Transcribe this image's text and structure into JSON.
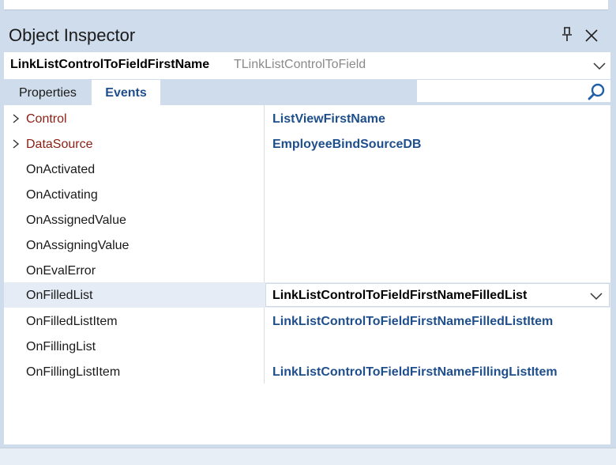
{
  "panel": {
    "title": "Object Inspector"
  },
  "selector": {
    "object_name": "LinkListControlToFieldFirstName",
    "object_type": "TLinkListControlToField"
  },
  "tabs": [
    {
      "label": "Properties",
      "active": false
    },
    {
      "label": "Events",
      "active": true
    }
  ],
  "search": {
    "value": "",
    "icon": "search-icon"
  },
  "rows": [
    {
      "name": "Control",
      "value": "ListViewFirstName",
      "expandable": true
    },
    {
      "name": "DataSource",
      "value": "EmployeeBindSourceDB",
      "expandable": true
    },
    {
      "name": "OnActivated",
      "value": ""
    },
    {
      "name": "OnActivating",
      "value": ""
    },
    {
      "name": "OnAssignedValue",
      "value": ""
    },
    {
      "name": "OnAssigningValue",
      "value": ""
    },
    {
      "name": "OnEvalError",
      "value": ""
    },
    {
      "name": "OnFilledList",
      "value": "LinkListControlToFieldFirstNameFilledList",
      "selected": true
    },
    {
      "name": "OnFilledListItem",
      "value": "LinkListControlToFieldFirstNameFilledListItem"
    },
    {
      "name": "OnFillingList",
      "value": ""
    },
    {
      "name": "OnFillingListItem",
      "value": "LinkListControlToFieldFirstNameFillingListItem"
    }
  ],
  "colors": {
    "accent": "#1e4f8c",
    "reference_property": "#8b1e12",
    "panel_background": "#cfdceb",
    "selected_row": "#e5ecf5"
  }
}
